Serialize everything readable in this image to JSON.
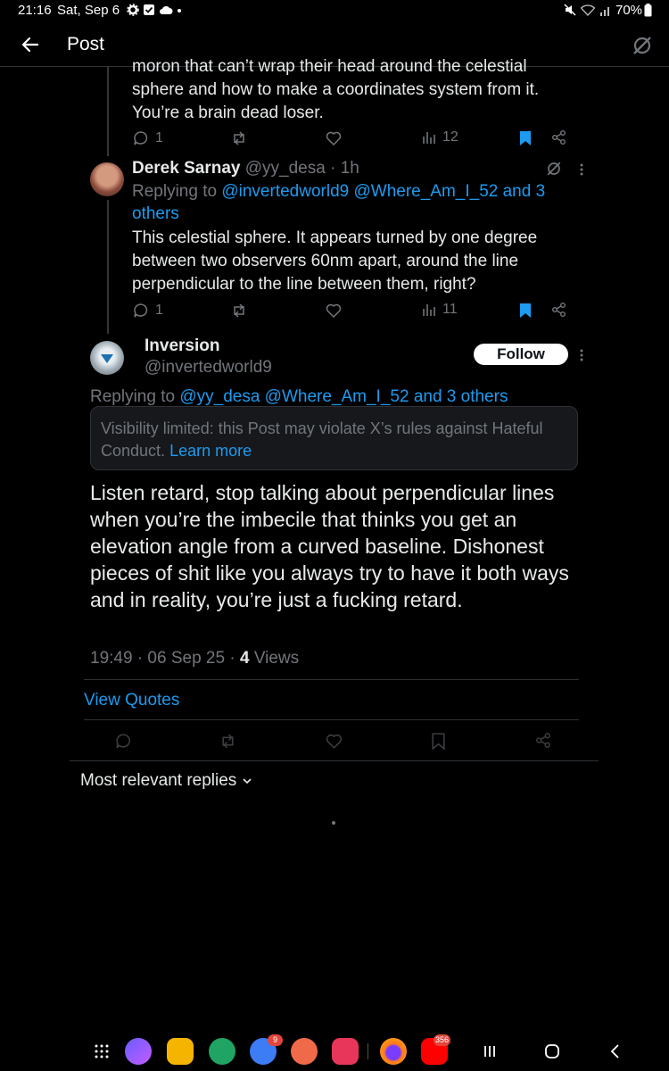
{
  "status_bar": {
    "time": "21:16",
    "date": "Sat, Sep 6",
    "battery": "70%"
  },
  "header": {
    "title": "Post"
  },
  "prev_tweet": {
    "text_lines": [
      "moron that can’t wrap their head around the celestial",
      "sphere and how to make a coordinates system from it.",
      "You’re a brain dead loser."
    ],
    "replies": "1",
    "views": "12"
  },
  "reply_tweet": {
    "name": "Derek Sarnay",
    "handle": "@yy_desa",
    "time": "· 1h",
    "replying_prefix": "Replying to",
    "replying_mentions_line1": "@invertedworld9 @Where_Am_I_52 and 3",
    "replying_mentions_line2": "others",
    "text_lines": [
      "This celestial sphere. It appears turned by one degree",
      "between two observers 60nm apart, around the line",
      "perpendicular to the line between them, right?"
    ],
    "replies": "1",
    "views": "11"
  },
  "main_post": {
    "name": "Inversion",
    "handle": "@invertedworld9",
    "follow_label": "Follow",
    "replying_prefix": "Replying to",
    "replying_mentions": "@yy_desa @Where_Am_I_52 and 3 others",
    "notice_text": "Visibility limited: this Post may violate X’s rules against Hateful Conduct.",
    "notice_link": "Learn more",
    "text": "Listen retard, stop talking about perpendicular lines when you’re the imbecile that thinks you get an elevation angle from a curved baseline. Dishonest pieces of shit like you always try to have it both ways and in reality, you’re just a fucking retard.",
    "timestamp": "19:49 · 06 Sep 25 ·",
    "views_count": "4",
    "views_label": "Views",
    "view_quotes": "View Quotes"
  },
  "replies_section": {
    "sort_label": "Most relevant replies"
  },
  "nav_bar": {
    "messages_badge": "9",
    "youtube_badge": "356"
  },
  "colors": {
    "background": "#000000",
    "accent_blue": "#1d9bf0",
    "muted": "#71767b",
    "bookmark_active": "#1d9bf0"
  }
}
